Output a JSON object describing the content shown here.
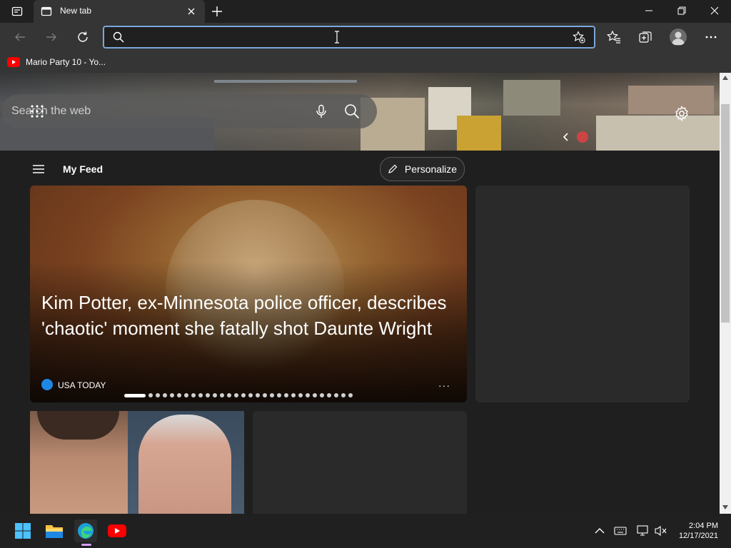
{
  "browser": {
    "tab": {
      "title": "New tab"
    },
    "address_bar": {
      "value": "",
      "placeholder": ""
    },
    "favorites": [
      {
        "label": "Mario Party 10 - Yo..."
      }
    ]
  },
  "hero": {
    "search_placeholder": "Search the web"
  },
  "feed": {
    "title": "My Feed",
    "personalize_label": "Personalize",
    "main_story": {
      "headline": "Kim Potter, ex-Minnesota police officer, describes 'chaotic' moment she fatally shot Daunte Wright",
      "source": "USA TODAY",
      "more": "···",
      "carousel": {
        "count": 30,
        "active_index": 0
      }
    }
  },
  "taskbar": {
    "time": "2:04 PM",
    "date": "12/17/2021",
    "pinned": [
      "start-icon",
      "file-explorer-icon",
      "edge-icon",
      "youtube-icon"
    ]
  },
  "colors": {
    "accent": "#7ba7d8",
    "youtube_red": "#ff0000",
    "usa_today_blue": "#1e88e5"
  }
}
